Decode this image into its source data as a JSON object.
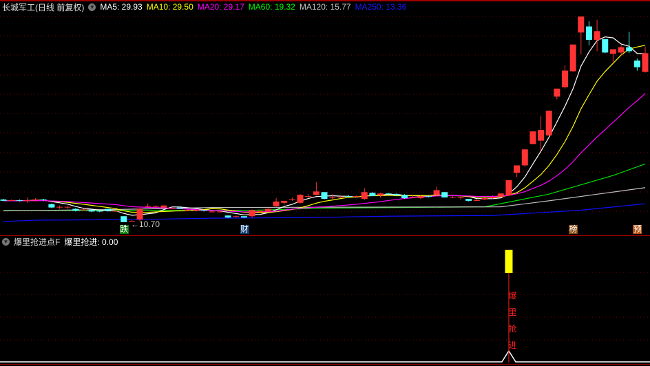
{
  "header": {
    "title": "长城军工(日线 前复权)",
    "ma": [
      {
        "label": "MA5: 29.93",
        "color": "#ffffff"
      },
      {
        "label": "MA10: 29.50",
        "color": "#ffff00"
      },
      {
        "label": "MA20: 29.17",
        "color": "#ff00ff"
      },
      {
        "label": "MA60: 19.32",
        "color": "#00ff00"
      },
      {
        "label": "MA120: 15.77",
        "color": "#c8c8c8"
      },
      {
        "label": "MA250: 13.36",
        "color": "#0000ff"
      }
    ]
  },
  "low_label": "←10.70",
  "markers": [
    {
      "text": "跌",
      "bg": "#0a7a0a",
      "index": 15
    },
    {
      "text": "财",
      "bg": "#0f3a6a",
      "index": 30
    },
    {
      "text": "榜",
      "bg": "#8a4a10",
      "index": 71
    },
    {
      "text": "预",
      "bg": "#b05010",
      "index": 79
    }
  ],
  "sub": {
    "title": "爆里抢进点F",
    "value_label": "爆里抢进: 0.00",
    "signal_text": [
      "爆",
      "里",
      "抢",
      "进"
    ],
    "signal_index": 63
  },
  "colors": {
    "up": "#ff3333",
    "down": "#54ffff",
    "grid": "#7a0000"
  },
  "chart_data": {
    "type": "candlestick",
    "price_range": [
      10.7,
      41.4
    ],
    "candles_ohlc": [
      [
        14.0,
        14.1,
        13.8,
        13.8
      ],
      [
        13.9,
        14.0,
        13.8,
        13.9
      ],
      [
        13.9,
        14.0,
        13.7,
        13.8
      ],
      [
        13.8,
        14.3,
        13.5,
        13.9
      ],
      [
        13.9,
        14.2,
        13.7,
        14.0
      ],
      [
        14.0,
        14.1,
        13.8,
        13.9
      ],
      [
        13.3,
        13.4,
        12.7,
        12.8
      ],
      [
        12.8,
        13.1,
        12.6,
        12.9
      ],
      [
        12.8,
        13.0,
        12.6,
        12.9
      ],
      [
        12.6,
        12.7,
        12.2,
        12.3
      ],
      [
        12.5,
        12.6,
        12.3,
        12.5
      ],
      [
        12.4,
        12.5,
        12.1,
        12.2
      ],
      [
        12.3,
        12.4,
        12.1,
        12.2
      ],
      [
        12.6,
        12.6,
        12.2,
        12.3
      ],
      [
        12.2,
        12.4,
        12.1,
        12.3
      ],
      [
        11.5,
        11.5,
        10.6,
        10.6
      ],
      [
        10.7,
        10.9,
        10.7,
        10.8
      ],
      [
        11.0,
        12.7,
        10.8,
        12.6
      ],
      [
        13.0,
        13.4,
        12.9,
        13.0
      ],
      [
        12.9,
        13.1,
        12.8,
        13.0
      ],
      [
        12.8,
        13.1,
        12.7,
        13.1
      ],
      [
        12.7,
        12.8,
        12.6,
        12.7
      ],
      [
        12.8,
        12.8,
        12.6,
        12.6
      ],
      [
        12.4,
        12.5,
        12.3,
        12.4
      ],
      [
        12.3,
        12.5,
        12.3,
        12.4
      ],
      [
        12.4,
        12.4,
        12.2,
        12.3
      ],
      [
        12.2,
        12.3,
        12.1,
        12.2
      ],
      [
        12.1,
        12.3,
        12.0,
        12.2
      ],
      [
        11.6,
        11.6,
        11.2,
        11.3
      ],
      [
        11.4,
        11.6,
        11.3,
        11.5
      ],
      [
        11.5,
        11.5,
        11.2,
        11.3
      ],
      [
        11.5,
        12.5,
        11.3,
        12.4
      ],
      [
        12.1,
        12.4,
        12.0,
        12.3
      ],
      [
        12.2,
        12.7,
        12.1,
        12.6
      ],
      [
        13.0,
        14.2,
        12.9,
        13.7
      ],
      [
        13.5,
        13.8,
        13.2,
        13.8
      ],
      [
        13.9,
        14.3,
        13.8,
        14.0
      ],
      [
        13.5,
        14.8,
        13.4,
        14.7
      ],
      [
        14.5,
        14.8,
        14.3,
        14.5
      ],
      [
        14.7,
        16.6,
        14.6,
        15.2
      ],
      [
        15.1,
        15.1,
        14.0,
        14.1
      ],
      [
        14.2,
        14.8,
        14.1,
        14.3
      ],
      [
        14.3,
        14.5,
        14.2,
        14.4
      ],
      [
        14.5,
        14.7,
        14.3,
        14.4
      ],
      [
        14.4,
        14.6,
        14.3,
        14.5
      ],
      [
        14.1,
        15.7,
        13.9,
        15.1
      ],
      [
        15.0,
        15.1,
        14.5,
        14.5
      ],
      [
        14.6,
        15.0,
        14.3,
        14.9
      ],
      [
        14.9,
        15.0,
        14.7,
        14.8
      ],
      [
        14.8,
        14.9,
        14.6,
        14.6
      ],
      [
        14.7,
        14.8,
        14.1,
        14.2
      ],
      [
        14.3,
        14.6,
        14.2,
        14.4
      ],
      [
        14.2,
        14.6,
        14.1,
        14.5
      ],
      [
        14.5,
        14.6,
        14.3,
        14.4
      ],
      [
        14.7,
        15.9,
        14.6,
        15.4
      ],
      [
        15.1,
        15.1,
        14.3,
        14.3
      ],
      [
        14.3,
        14.5,
        14.2,
        14.4
      ],
      [
        14.2,
        14.4,
        14.0,
        14.3
      ],
      [
        14.1,
        14.1,
        13.7,
        13.8
      ],
      [
        13.9,
        14.1,
        13.8,
        13.9
      ],
      [
        14.0,
        14.3,
        13.9,
        14.2
      ],
      [
        14.2,
        14.6,
        14.1,
        14.4
      ],
      [
        14.4,
        14.9,
        14.3,
        14.9
      ],
      [
        14.6,
        16.9,
        14.5,
        16.9
      ],
      [
        18.0,
        19.1,
        17.3,
        19.1
      ],
      [
        19.1,
        21.5,
        18.9,
        21.5
      ],
      [
        22.3,
        24.2,
        22.3,
        24.2
      ],
      [
        22.8,
        26.5,
        21.3,
        24.4
      ],
      [
        23.6,
        27.3,
        23.6,
        27.3
      ],
      [
        29.4,
        30.6,
        29.0,
        30.6
      ],
      [
        30.8,
        34.1,
        30.6,
        33.3
      ],
      [
        33.2,
        37.2,
        33.1,
        37.2
      ],
      [
        39.0,
        41.4,
        35.7,
        41.4
      ],
      [
        39.9,
        40.7,
        37.1,
        37.9
      ],
      [
        37.9,
        40.9,
        36.2,
        39.2
      ],
      [
        38.0,
        38.0,
        35.9,
        36.0
      ],
      [
        35.8,
        36.5,
        34.6,
        36.5
      ],
      [
        36.0,
        37.1,
        35.6,
        36.8
      ],
      [
        36.8,
        39.1,
        35.9,
        36.2
      ],
      [
        34.8,
        35.1,
        33.3,
        33.8
      ],
      [
        33.1,
        36.9,
        33.0,
        35.9
      ]
    ],
    "ma_computed": [
      {
        "name": "MA5",
        "period": 5
      },
      {
        "name": "MA10",
        "period": 10
      },
      {
        "name": "MA20",
        "period": 20
      }
    ],
    "ma_knots": [
      {
        "name": "MA60",
        "points": [
          [
            0,
            12.35
          ],
          [
            30,
            12.35
          ],
          [
            40,
            12.7
          ],
          [
            60,
            12.9
          ],
          [
            68,
            14.8
          ],
          [
            76,
            17.6
          ],
          [
            80,
            19.32
          ]
        ]
      },
      {
        "name": "MA120",
        "points": [
          [
            0,
            12.3
          ],
          [
            14,
            12.5
          ],
          [
            26,
            12.8
          ],
          [
            62,
            12.9
          ],
          [
            68,
            13.8
          ],
          [
            80,
            15.77
          ]
        ]
      },
      {
        "name": "MA250",
        "points": [
          [
            0,
            10.7
          ],
          [
            4,
            10.9
          ],
          [
            17,
            11.0
          ],
          [
            26,
            11.2
          ],
          [
            39,
            11.3
          ],
          [
            48,
            11.5
          ],
          [
            61,
            11.6
          ],
          [
            72,
            12.4
          ],
          [
            80,
            13.36
          ]
        ]
      }
    ]
  }
}
